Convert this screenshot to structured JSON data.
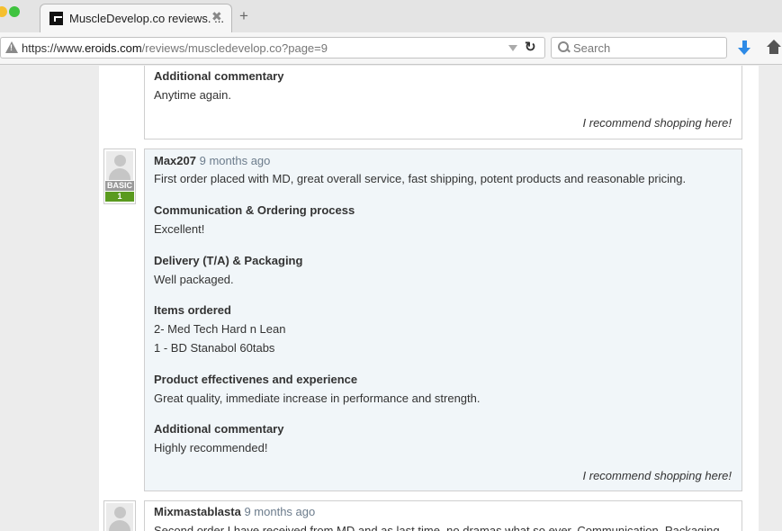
{
  "browser": {
    "tab_title": "MuscleDevelop.co reviews. ...",
    "tab_close": "✖",
    "new_tab": "+",
    "url_prefix": "https://www.",
    "url_host": "eroids.com",
    "url_path": "/reviews/muscledevelop.co?page=9",
    "search_placeholder": "Search",
    "reload_glyph": "↻"
  },
  "reviews": [
    {
      "sections": [
        {
          "heading": "Additional commentary",
          "text": [
            "Anytime again."
          ]
        }
      ],
      "recommend": "I recommend shopping here!"
    },
    {
      "reviewer": "Max207",
      "time": "9 months ago",
      "badge": "BASIC",
      "level": "1",
      "intro": "First order placed with MD, great overall service, fast shipping, potent products and reasonable pricing.",
      "sections": [
        {
          "heading": "Communication & Ordering process",
          "text": [
            "Excellent!"
          ]
        },
        {
          "heading": "Delivery (T/A) & Packaging",
          "text": [
            "Well packaged."
          ]
        },
        {
          "heading": "Items ordered",
          "text": [
            "2- Med Tech Hard n Lean",
            "1 - BD Stanabol 60tabs"
          ]
        },
        {
          "heading": "Product effectivenes and experience",
          "text": [
            "Great quality, immediate increase in performance and strength."
          ]
        },
        {
          "heading": "Additional commentary",
          "text": [
            "Highly recommended!"
          ]
        }
      ],
      "recommend": "I recommend shopping here!"
    },
    {
      "reviewer": "Mixmastablasta",
      "time": "9 months ago",
      "intro": "Second order I have received from MD and as last time, no dramas what so ever. Communication, Packaging"
    }
  ]
}
